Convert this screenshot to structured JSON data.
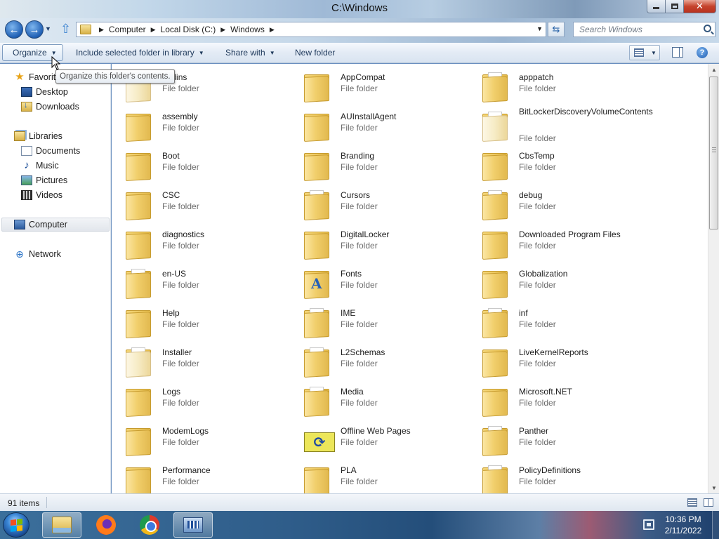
{
  "window": {
    "title": "C:\\Windows",
    "minimize_label": "",
    "close_label": "✕"
  },
  "address": {
    "crumbs": [
      "Computer",
      "Local Disk (C:)",
      "Windows"
    ]
  },
  "search": {
    "placeholder": "Search Windows"
  },
  "commands": {
    "organize": "Organize",
    "include": "Include selected folder in library",
    "share": "Share with",
    "new_folder": "New folder"
  },
  "tooltip": "Organize this folder's contents.",
  "nav": {
    "favorites": "Favorites",
    "desktop": "Desktop",
    "downloads": "Downloads",
    "libraries": "Libraries",
    "documents": "Documents",
    "music": "Music",
    "pictures": "Pictures",
    "videos": "Videos",
    "computer": "Computer",
    "network": "Network"
  },
  "folders": [
    {
      "name": "addins",
      "type": "File folder"
    },
    {
      "name": "AppCompat",
      "type": "File folder"
    },
    {
      "name": "apppatch",
      "type": "File folder"
    },
    {
      "name": "assembly",
      "type": "File folder"
    },
    {
      "name": "AUInstallAgent",
      "type": "File folder"
    },
    {
      "name": "BitLockerDiscoveryVolumeContents",
      "type": "File folder"
    },
    {
      "name": "Boot",
      "type": "File folder"
    },
    {
      "name": "Branding",
      "type": "File folder"
    },
    {
      "name": "CbsTemp",
      "type": "File folder"
    },
    {
      "name": "CSC",
      "type": "File folder"
    },
    {
      "name": "Cursors",
      "type": "File folder"
    },
    {
      "name": "debug",
      "type": "File folder"
    },
    {
      "name": "diagnostics",
      "type": "File folder"
    },
    {
      "name": "DigitalLocker",
      "type": "File folder"
    },
    {
      "name": "Downloaded Program Files",
      "type": "File folder"
    },
    {
      "name": "en-US",
      "type": "File folder"
    },
    {
      "name": "Fonts",
      "type": "File folder"
    },
    {
      "name": "Globalization",
      "type": "File folder"
    },
    {
      "name": "Help",
      "type": "File folder"
    },
    {
      "name": "IME",
      "type": "File folder"
    },
    {
      "name": "inf",
      "type": "File folder"
    },
    {
      "name": "Installer",
      "type": "File folder"
    },
    {
      "name": "L2Schemas",
      "type": "File folder"
    },
    {
      "name": "LiveKernelReports",
      "type": "File folder"
    },
    {
      "name": "Logs",
      "type": "File folder"
    },
    {
      "name": "Media",
      "type": "File folder"
    },
    {
      "name": "Microsoft.NET",
      "type": "File folder"
    },
    {
      "name": "ModemLogs",
      "type": "File folder"
    },
    {
      "name": "Offline Web Pages",
      "type": "File folder"
    },
    {
      "name": "Panther",
      "type": "File folder"
    },
    {
      "name": "Performance",
      "type": "File folder"
    },
    {
      "name": "PLA",
      "type": "File folder"
    },
    {
      "name": "PolicyDefinitions",
      "type": "File folder"
    }
  ],
  "status": {
    "item_count": "91 items"
  },
  "clock": {
    "time": "10:36 PM",
    "date": "2/11/2022"
  }
}
